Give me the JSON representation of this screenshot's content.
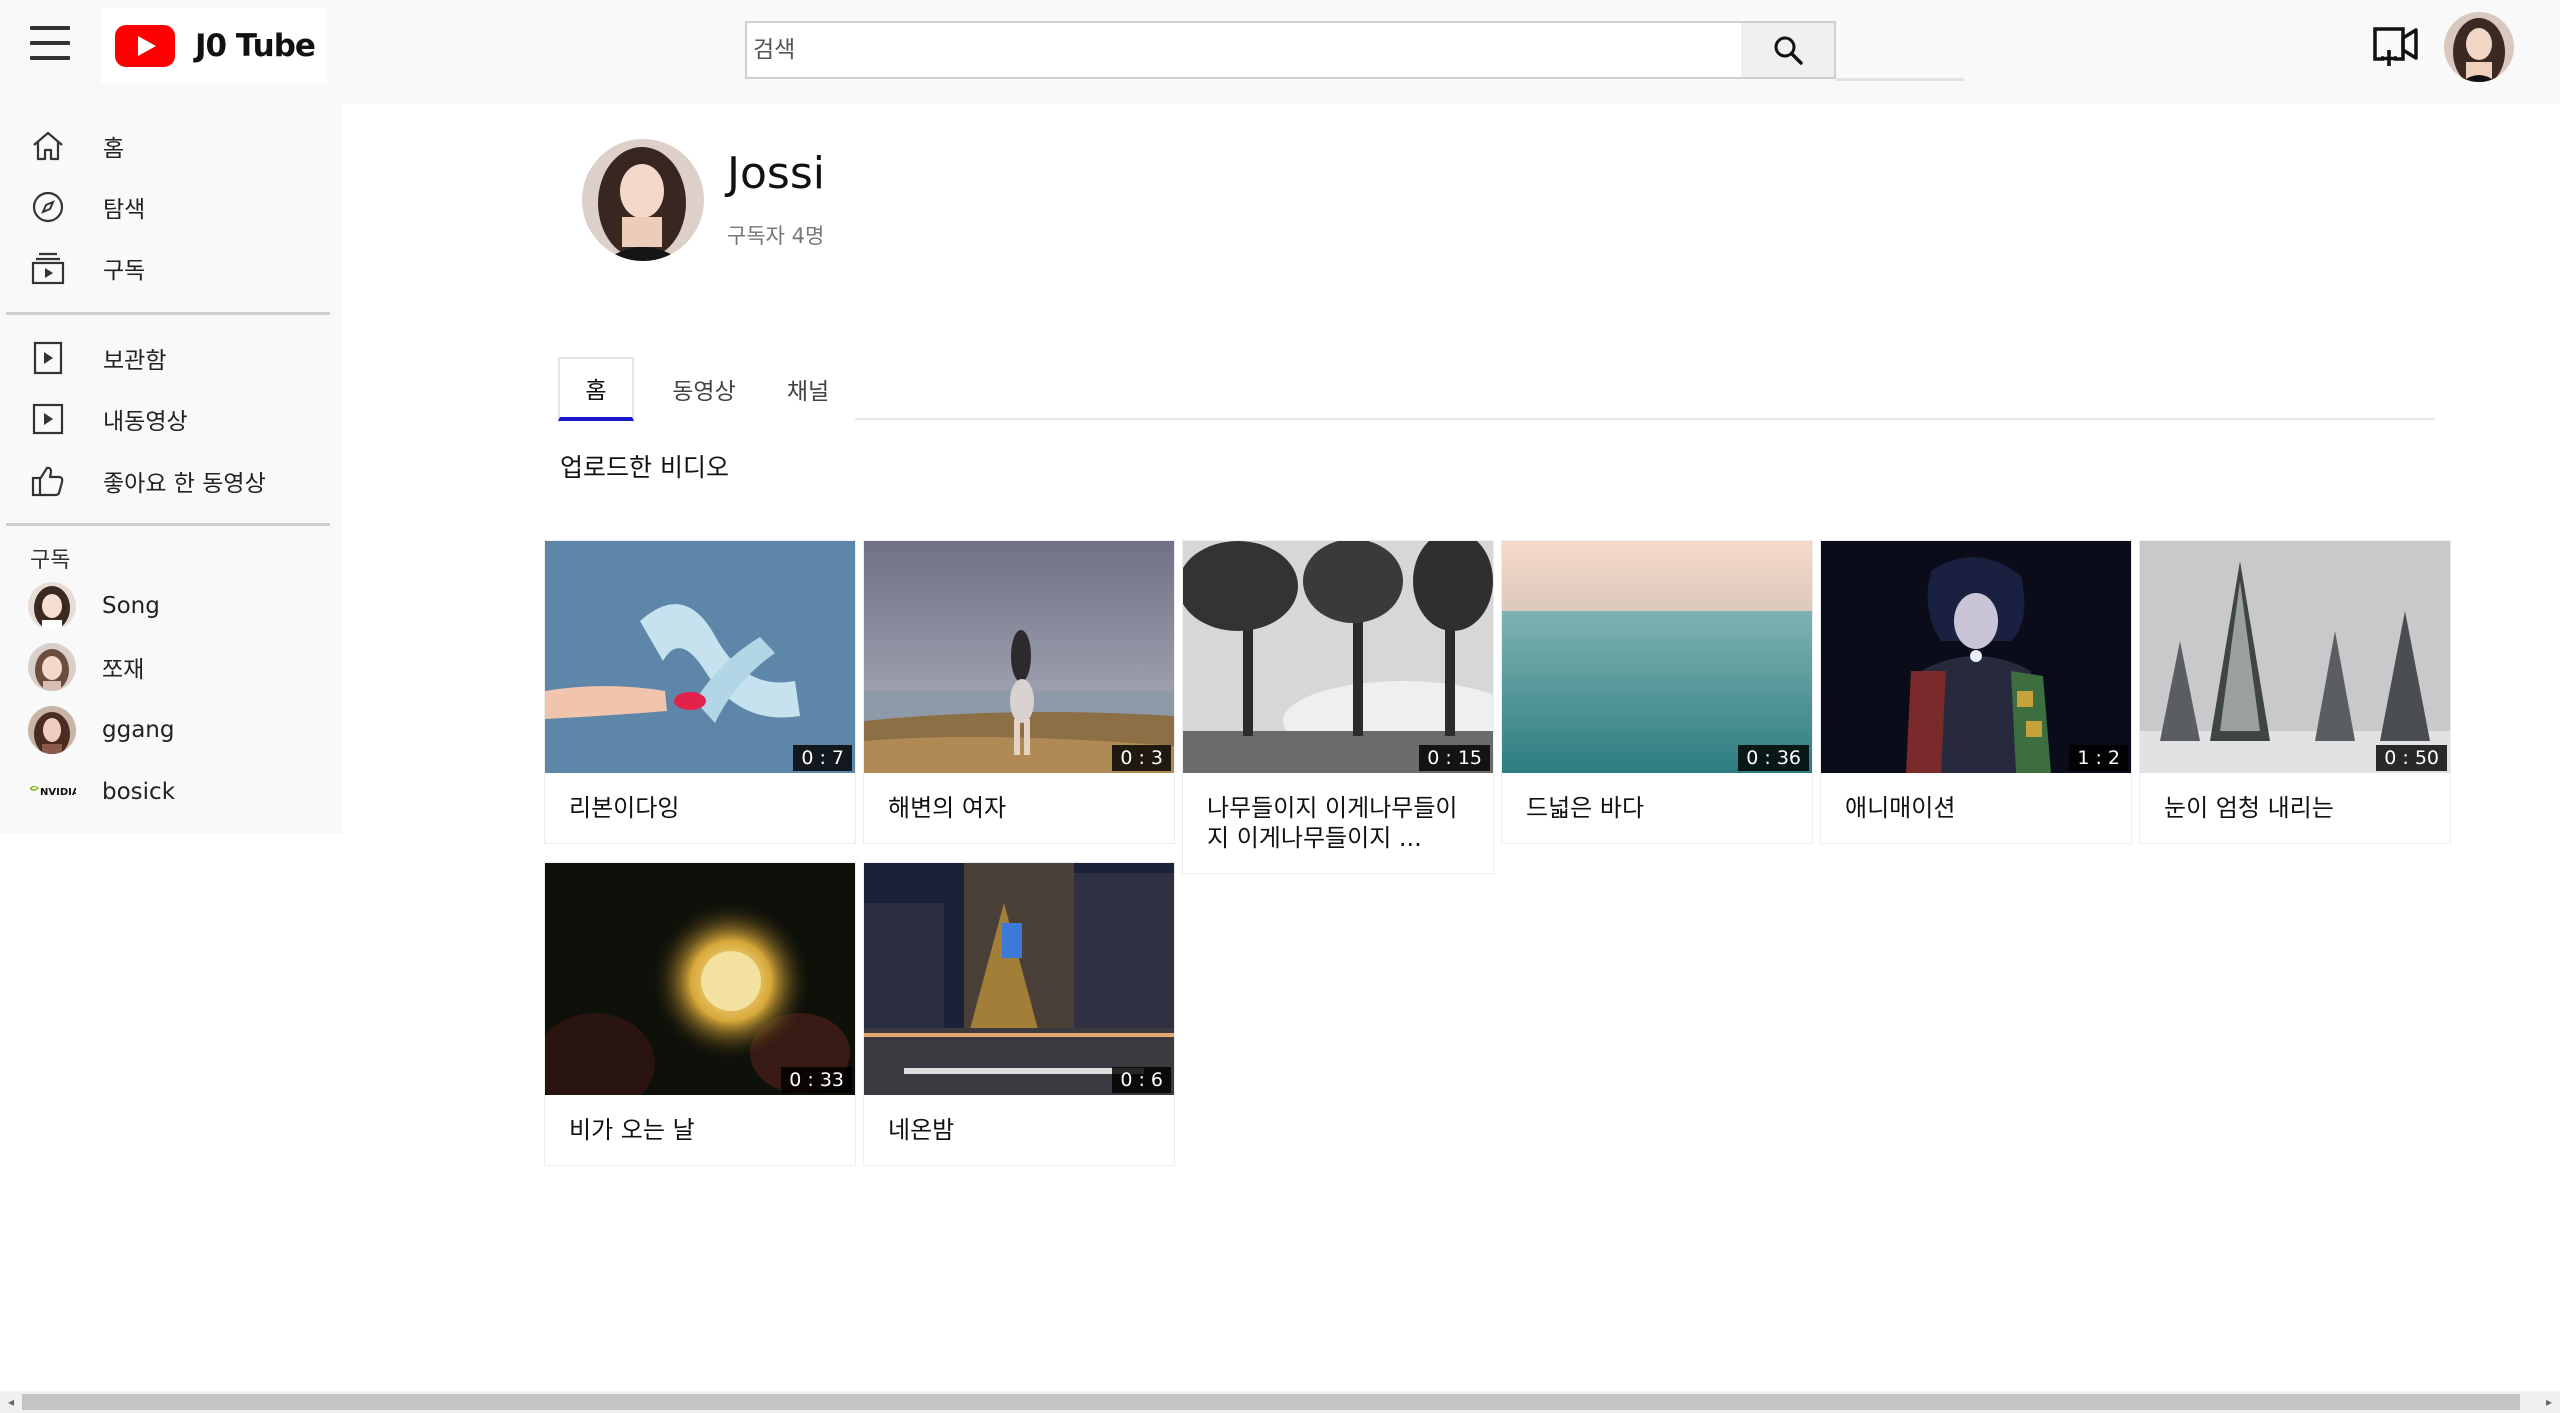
{
  "header": {
    "logo_text": "J0 Tube",
    "search_placeholder": "검색"
  },
  "sidebar": {
    "main_items": [
      {
        "label": "홈",
        "icon": "home-icon"
      },
      {
        "label": "탐색",
        "icon": "compass-icon"
      },
      {
        "label": "구독",
        "icon": "subscriptions-icon"
      }
    ],
    "library_items": [
      {
        "label": "보관함",
        "icon": "library-icon"
      },
      {
        "label": "내동영상",
        "icon": "my-videos-icon"
      },
      {
        "label": "좋아요 한 동영상",
        "icon": "thumbs-up-icon"
      }
    ],
    "subscriptions_heading": "구독",
    "subscriptions": [
      {
        "name": "Song"
      },
      {
        "name": "쪼재"
      },
      {
        "name": "ggang"
      },
      {
        "name": "bosick",
        "logo_text": "NVIDIA"
      }
    ]
  },
  "channel": {
    "name": "Jossi",
    "subscribers": "구독자 4명"
  },
  "tabs": [
    {
      "label": "홈",
      "active": true
    },
    {
      "label": "동영상",
      "active": false
    },
    {
      "label": "채널",
      "active": false
    }
  ],
  "section_title": "업로드한 비디오",
  "videos": [
    {
      "title": "리본이다잉",
      "duration": "0 : 7"
    },
    {
      "title": "해변의 여자",
      "duration": "0 : 3"
    },
    {
      "title": "나무들이지 이게나무들이지 이게나무들이지 ...",
      "duration": "0 : 15"
    },
    {
      "title": "드넓은 바다",
      "duration": "0 : 36"
    },
    {
      "title": "애니매이션",
      "duration": "1 : 2"
    },
    {
      "title": "눈이 엄청 내리는",
      "duration": "0 : 50"
    },
    {
      "title": "비가 오는 날",
      "duration": "0 : 33"
    },
    {
      "title": "네온밤",
      "duration": "0 : 6"
    }
  ],
  "colors": {
    "brand_red": "#ff0000",
    "active_tab_underline": "#1a1acc",
    "sidebar_bg": "#f9f9f9"
  }
}
